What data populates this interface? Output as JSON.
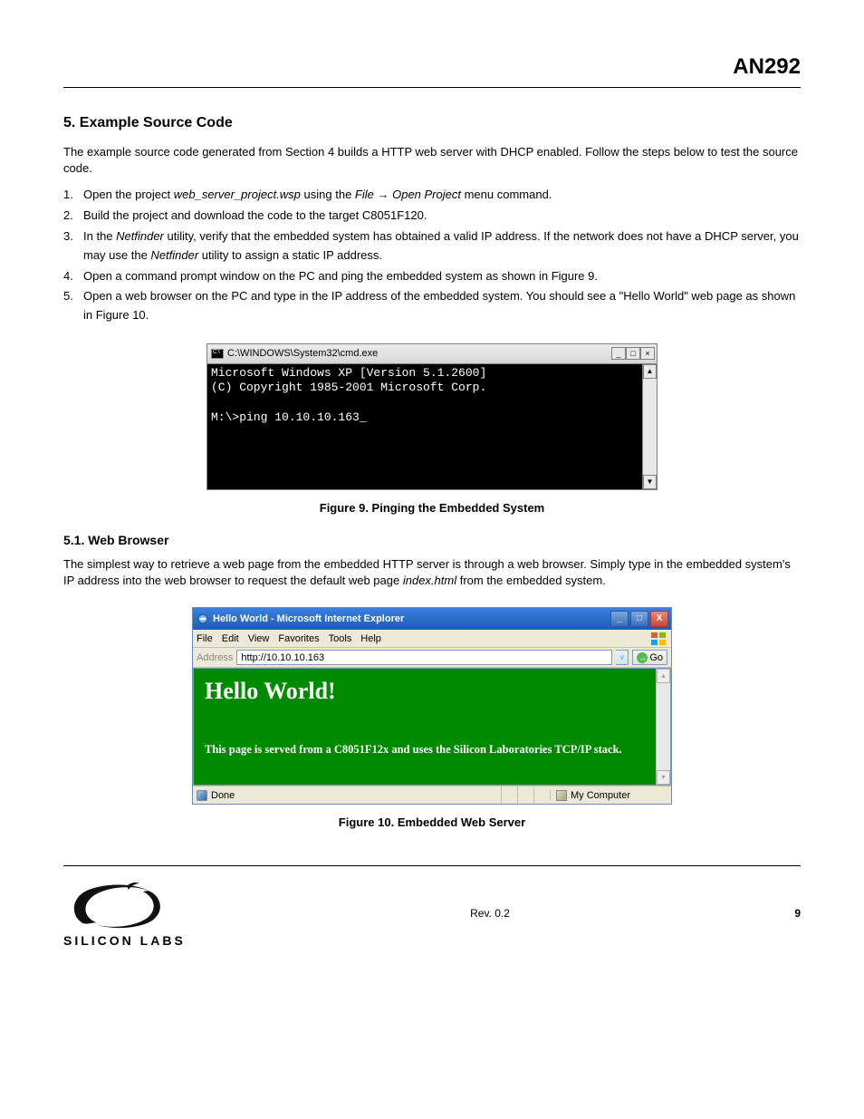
{
  "header": {
    "doc_code": "AN292"
  },
  "section": {
    "number_title": "5. Example Source Code"
  },
  "intro": "The example source code generated from Section 4 builds a HTTP web server with DHCP enabled. Follow the steps below to test the source code.",
  "steps": {
    "s1": "Open the project web_server_project.wsp using the File → Open Project menu command.",
    "s2": "Build the project and download the code to the target C8051F120.",
    "s3_a": "In the ",
    "s3_b": "Netfinder",
    "s3_c": " utility, verify that the embedded system has obtained a valid IP address. If the network does not have a DHCP server, you may use the ",
    "s3_d": "Netfinder",
    "s3_e": " utility to assign a static IP address.",
    "s4_a": "Open a command prompt window on the PC and ping the embedded system as shown in ",
    "s4_b": "Figure 9",
    "s4_c": ".",
    "s5_a": "Open a web browser on the PC and type in the IP address of the embedded system. You should see a \"Hello World\" web page as shown in ",
    "s5_b": "Figure 10",
    "s5_c": "."
  },
  "cmd": {
    "title": "C:\\WINDOWS\\System32\\cmd.exe",
    "line1": "Microsoft Windows XP [Version 5.1.2600]",
    "line2": "(C) Copyright 1985-2001 Microsoft Corp.",
    "prompt_line": "M:\\>ping 10.10.10.163_"
  },
  "fig9_caption": "Figure 9. Pinging the Embedded System",
  "subsection": {
    "title": "5.1. Web Browser"
  },
  "web_text_a": "The simplest way to retrieve a web page from the embedded HTTP server is through a web browser. Simply type in the embedded system's IP address into the web browser to request the default web page ",
  "web_text_b": "index.html",
  "web_text_c": " from the embedded system.",
  "ie": {
    "title": "Hello World - Microsoft Internet Explorer",
    "menu": {
      "file": "File",
      "edit": "Edit",
      "view": "View",
      "favorites": "Favorites",
      "tools": "Tools",
      "help": "Help"
    },
    "addr_label": "Address",
    "url": "http://10.10.10.163",
    "go": "Go",
    "page_h1": "Hello World!",
    "page_sub": "This page is served from a C8051F12x and uses the Silicon Laboratories TCP/IP stack.",
    "status_done": "Done",
    "status_zone": "My Computer"
  },
  "fig10_caption": "Figure 10. Embedded Web Server",
  "footer": {
    "rev": "Rev. 0.2",
    "page": "9"
  },
  "logo_text": "SILICON LABS"
}
